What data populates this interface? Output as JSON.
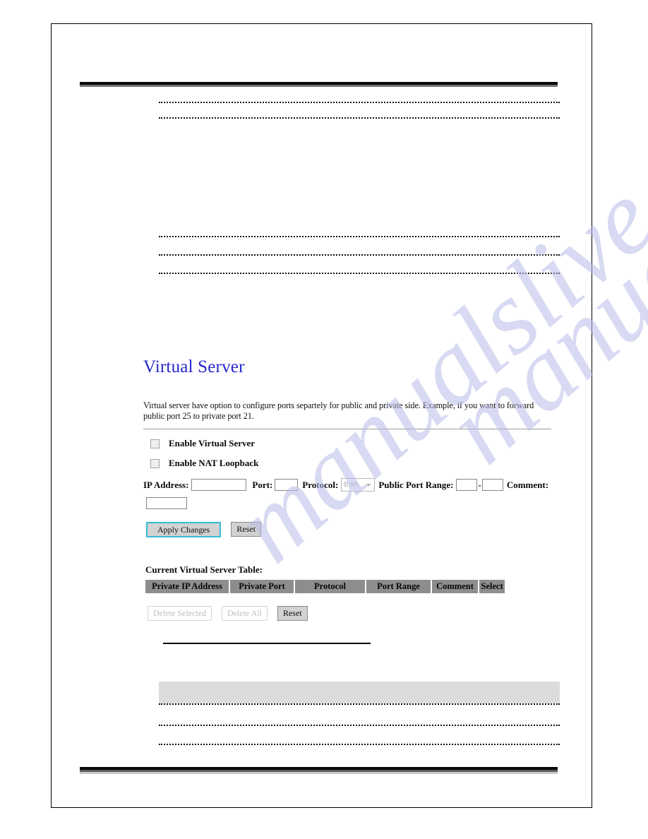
{
  "page": {
    "watermark": "manualslive.com"
  },
  "virtual_server": {
    "title": "Virtual Server",
    "description": "Virtual server have option to configure ports separtely for public and private side. Example, if you want to forward public port 25 to private port 21.",
    "title_color": "#2626cc",
    "checkboxes": [
      {
        "label": "Enable Virtual Server",
        "checked": false
      },
      {
        "label": "Enable NAT Loopback",
        "checked": false
      }
    ],
    "fields": {
      "ip_address_label": "IP Address:",
      "ip_address_value": "",
      "port_label": "Port:",
      "port_value": "",
      "protocol_label": "Protocol:",
      "protocol_value": "Both",
      "protocol_options": [
        "Both"
      ],
      "public_port_range_label": "Public Port Range:",
      "public_port_range_start": "",
      "public_port_range_end": "",
      "range_separator": "-",
      "comment_label": "Comment:",
      "comment_value": ""
    },
    "buttons": {
      "apply_changes": "Apply Changes",
      "reset": "Reset"
    },
    "table": {
      "caption": "Current Virtual Server Table:",
      "columns": [
        "Private IP Address",
        "Private Port",
        "Protocol",
        "Port Range",
        "Comment",
        "Select"
      ],
      "rows": [],
      "header_bg": "#8d8d8d"
    },
    "table_buttons": {
      "delete_selected": "Delete Selected",
      "delete_selected_disabled": true,
      "delete_all": "Delete All",
      "delete_all_disabled": true,
      "reset": "Reset",
      "reset_disabled": false
    }
  }
}
